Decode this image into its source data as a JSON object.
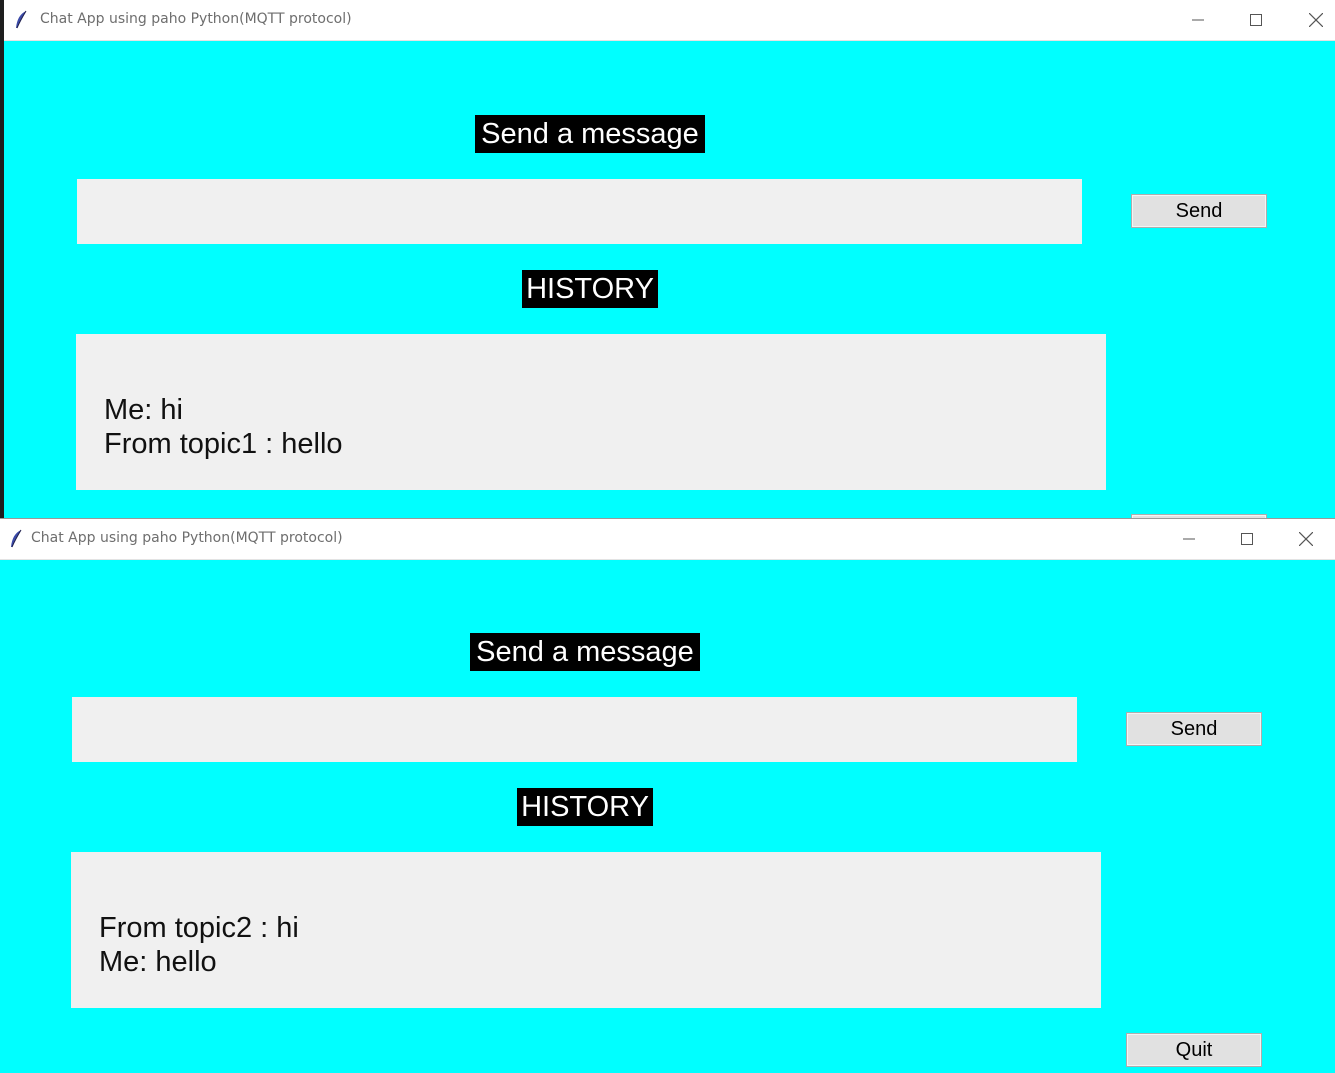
{
  "colors": {
    "window_bg": "#00ffff",
    "heading_bg": "#000000",
    "heading_fg": "#ffffff",
    "field_bg": "#f0f0f0",
    "button_bg": "#e1e1e1"
  },
  "windows": [
    {
      "title": "Chat App using paho Python(MQTT protocol)",
      "icon": "feather-icon",
      "controls": {
        "minimize": "minimize-icon",
        "maximize": "maximize-icon",
        "close": "close-icon"
      },
      "send_heading": "Send a message",
      "message_input_value": "",
      "send_button": "Send",
      "history_heading": "HISTORY",
      "history": [
        "Me: hi",
        "From topic1 : hello"
      ]
    },
    {
      "title": "Chat App using paho Python(MQTT protocol)",
      "icon": "feather-icon",
      "controls": {
        "minimize": "minimize-icon",
        "maximize": "maximize-icon",
        "close": "close-icon"
      },
      "send_heading": "Send a message",
      "message_input_value": "",
      "send_button": "Send",
      "history_heading": "HISTORY",
      "history": [
        "From topic2 : hi",
        "Me: hello"
      ],
      "quit_button": "Quit"
    }
  ]
}
